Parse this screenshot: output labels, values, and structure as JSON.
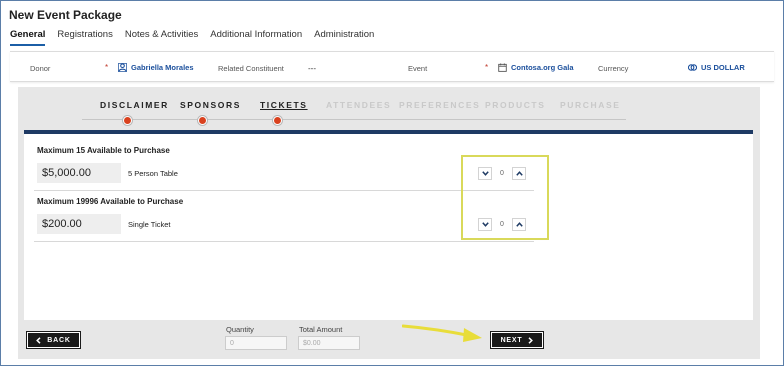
{
  "page_title": "New Event Package",
  "tabs": [
    {
      "label": "General",
      "active": true
    },
    {
      "label": "Registrations",
      "active": false
    },
    {
      "label": "Notes & Activities",
      "active": false
    },
    {
      "label": "Additional Information",
      "active": false
    },
    {
      "label": "Administration",
      "active": false
    }
  ],
  "infobar": {
    "donor_label": "Donor",
    "donor_value": "Gabriella Morales",
    "related_label": "Related Constituent",
    "related_value": "---",
    "event_label": "Event",
    "event_value": "Contosa.org Gala",
    "currency_label": "Currency",
    "currency_value": "US DOLLAR",
    "required_mark": "*"
  },
  "steps": [
    {
      "label": "DISCLAIMER",
      "state": "done"
    },
    {
      "label": "SPONSORS",
      "state": "done"
    },
    {
      "label": "TICKETS",
      "state": "current"
    },
    {
      "label": "ATTENDEES",
      "state": "future"
    },
    {
      "label": "PREFERENCES",
      "state": "future"
    },
    {
      "label": "PRODUCTS",
      "state": "future"
    },
    {
      "label": "PURCHASE",
      "state": "future"
    }
  ],
  "items": [
    {
      "heading": "Maximum 15 Available to Purchase",
      "price": "$5,000.00",
      "description": "5 Person Table",
      "quantity": "0"
    },
    {
      "heading": "Maximum 19996 Available to Purchase",
      "price": "$200.00",
      "description": "Single Ticket",
      "quantity": "0"
    }
  ],
  "footer": {
    "back_label": "BACK",
    "next_label": "NEXT",
    "quantity_label": "Quantity",
    "quantity_value": "0",
    "total_label": "Total Amount",
    "total_value": "$0.00"
  },
  "colors": {
    "accent": "#1b4f9c",
    "progress_dot": "#d9411e",
    "content_bar": "#1e3a64",
    "highlight_box": "#d9d95a",
    "arrow": "#e8dd3a"
  },
  "icons": {
    "donor": "person-icon",
    "event": "calendar-icon",
    "currency": "currency-icon",
    "back": "chevron-left-icon",
    "next": "chevron-right-icon",
    "decrement": "chevron-down-icon",
    "increment": "chevron-up-icon"
  }
}
